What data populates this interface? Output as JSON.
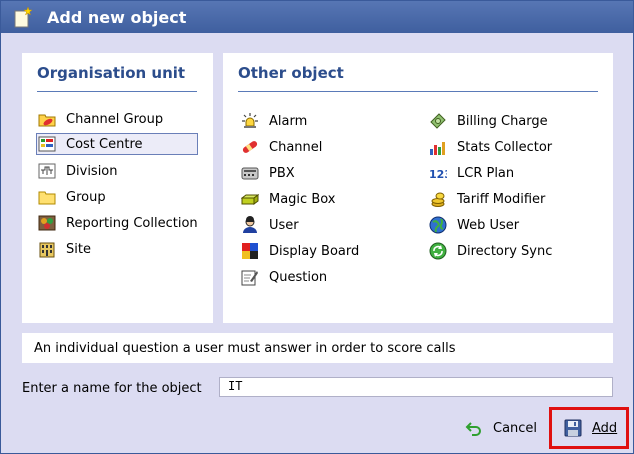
{
  "dialog": {
    "title": "Add new object"
  },
  "org_panel": {
    "title": "Organisation unit",
    "items": [
      {
        "label": "Channel Group",
        "icon": "channel-group-icon"
      },
      {
        "label": "Cost Centre",
        "icon": "cost-centre-icon",
        "selected": true
      },
      {
        "label": "Division",
        "icon": "division-icon"
      },
      {
        "label": "Group",
        "icon": "group-folder-icon"
      },
      {
        "label": "Reporting Collection",
        "icon": "reporting-collection-icon"
      },
      {
        "label": "Site",
        "icon": "site-building-icon"
      }
    ]
  },
  "other_panel": {
    "title": "Other object",
    "col1": [
      {
        "label": "Alarm",
        "icon": "alarm-icon"
      },
      {
        "label": "Channel",
        "icon": "channel-icon"
      },
      {
        "label": "PBX",
        "icon": "pbx-icon"
      },
      {
        "label": "Magic Box",
        "icon": "magic-box-icon"
      },
      {
        "label": "User",
        "icon": "user-icon"
      },
      {
        "label": "Display Board",
        "icon": "display-board-icon"
      },
      {
        "label": "Question",
        "icon": "question-icon"
      }
    ],
    "col2": [
      {
        "label": "Billing Charge",
        "icon": "billing-charge-icon"
      },
      {
        "label": "Stats Collector",
        "icon": "stats-collector-icon"
      },
      {
        "label": "LCR Plan",
        "icon": "lcr-plan-icon"
      },
      {
        "label": "Tariff Modifier",
        "icon": "tariff-modifier-icon"
      },
      {
        "label": "Web User",
        "icon": "web-user-icon"
      },
      {
        "label": "Directory Sync",
        "icon": "directory-sync-icon"
      }
    ]
  },
  "description": "An individual question a user must answer in order to score calls",
  "name_field": {
    "label": "Enter a name for the object",
    "value": "IT"
  },
  "buttons": {
    "cancel": "Cancel",
    "add": "Add"
  },
  "colors": {
    "title_bar": "#4a6aa9",
    "panel_title": "#2c4d8c",
    "dialog_bg": "#dcdcf2",
    "highlight_border": "#e01010"
  }
}
